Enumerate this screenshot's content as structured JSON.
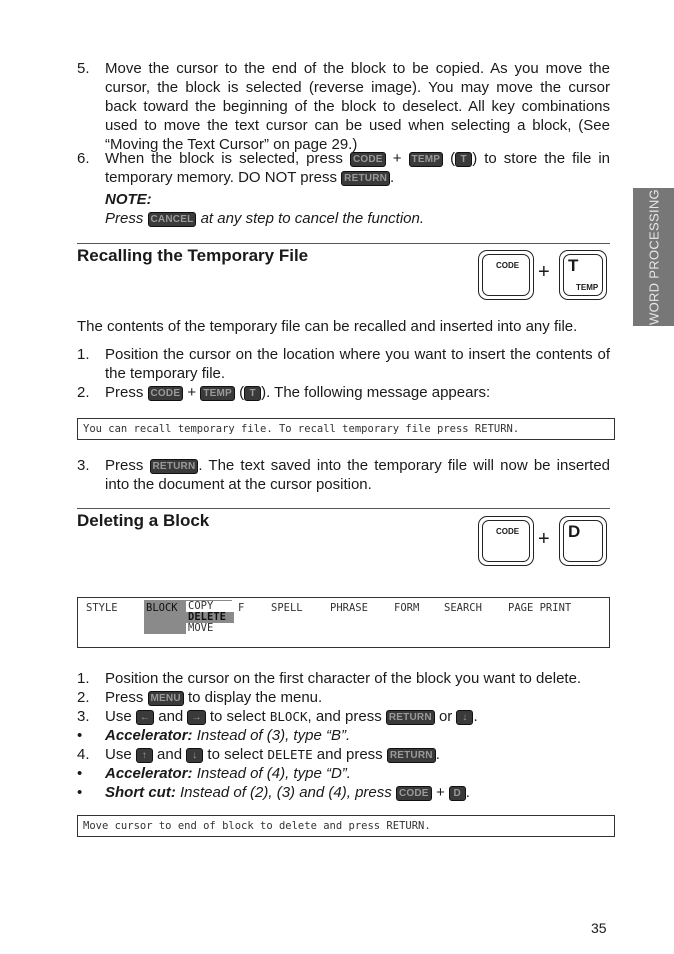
{
  "side_tab": "WORD PROCESSING",
  "copy_steps": [
    {
      "num": "5.",
      "text": "Move the cursor to the end of the block to be copied. As you move the cursor, the block is selected (reverse image). You may move the cursor back toward the beginning of the block to deselect. All key combinations used to move the text cursor can be used when selecting a block, (See “Moving the Text Cursor” on page 29.)"
    },
    {
      "num": "6.",
      "text_a": "When the block is selected, press",
      "key1": "CODE",
      "plus": "+",
      "key2": "TEMP",
      "key3": "T",
      "text_b": "to store the file in temporary memory. DO NOT press",
      "key4": "RETURN"
    }
  ],
  "note": {
    "title": "NOTE:",
    "text_a": "Press",
    "key": "CANCEL",
    "text_b": "at any step to cancel the function."
  },
  "recall": {
    "heading": "Recalling the Temporary File",
    "keycap1": "CODE",
    "keycap2_main": "T",
    "keycap2_sub": "TEMP",
    "plus": "+",
    "intro": "The contents of the temporary file can be recalled and inserted into any file.",
    "step1": {
      "num": "1.",
      "text": "Position the cursor on the location where you want to insert the contents of the temporary file."
    },
    "step2": {
      "num": "2.",
      "text_a": "Press",
      "key1": "CODE",
      "plus": "+",
      "key2": "TEMP",
      "key3": "T",
      "text_b": "). The following message appears:"
    },
    "message": "You can recall temporary file.  To recall temporary file press RETURN.",
    "step3": {
      "num": "3.",
      "text_a": "Press",
      "key": "RETURN",
      "text_b": ". The text saved into the temporary file will now be inserted into the document at the cursor position."
    }
  },
  "delete": {
    "heading": "Deleting a Block",
    "keycap1": "CODE",
    "keycap2_main": "D",
    "plus": "+",
    "menu_bar": [
      "STYLE",
      "BLOCK",
      "F",
      "SPELL",
      "PHRASE",
      "FORM",
      "SEARCH",
      "PAGE PRINT"
    ],
    "submenu": [
      "COPY",
      "DELETE",
      "MOVE"
    ],
    "steps": [
      {
        "num": "1.",
        "text": "Position the cursor on the first character of the block you want to delete."
      },
      {
        "num": "2.",
        "text_a": "Press",
        "key": "MENU",
        "text_b": "to display the menu."
      },
      {
        "num": "3.",
        "text_a": "Use",
        "key1": "←",
        "text_and": "and",
        "key2": "→",
        "text_b": "to select",
        "mono": "BLOCK",
        "text_c": ", and press",
        "key3": "RETURN",
        "text_or": "or",
        "key4": "↓",
        "text_end": "."
      },
      {
        "num": "•",
        "label": "Accelerator:",
        "text": "Instead of (3), type “B”."
      },
      {
        "num": "4.",
        "text_a": "Use",
        "key1": "↑",
        "text_and": "and",
        "key2": "↓",
        "text_b": "to select",
        "mono": "DELETE",
        "text_c": "and press",
        "key3": "RETURN",
        "text_end": "."
      },
      {
        "num": "•",
        "label": "Accelerator:",
        "text": "Instead of (4), type “D”."
      },
      {
        "num": "•",
        "label": "Short cut:",
        "text": "Instead of (2), (3) and (4), press",
        "key1": "CODE",
        "plus": "+",
        "key2": "D",
        "text_end": "."
      }
    ],
    "message": "Move cursor to end of block to delete and press RETURN."
  },
  "page_number": "35"
}
